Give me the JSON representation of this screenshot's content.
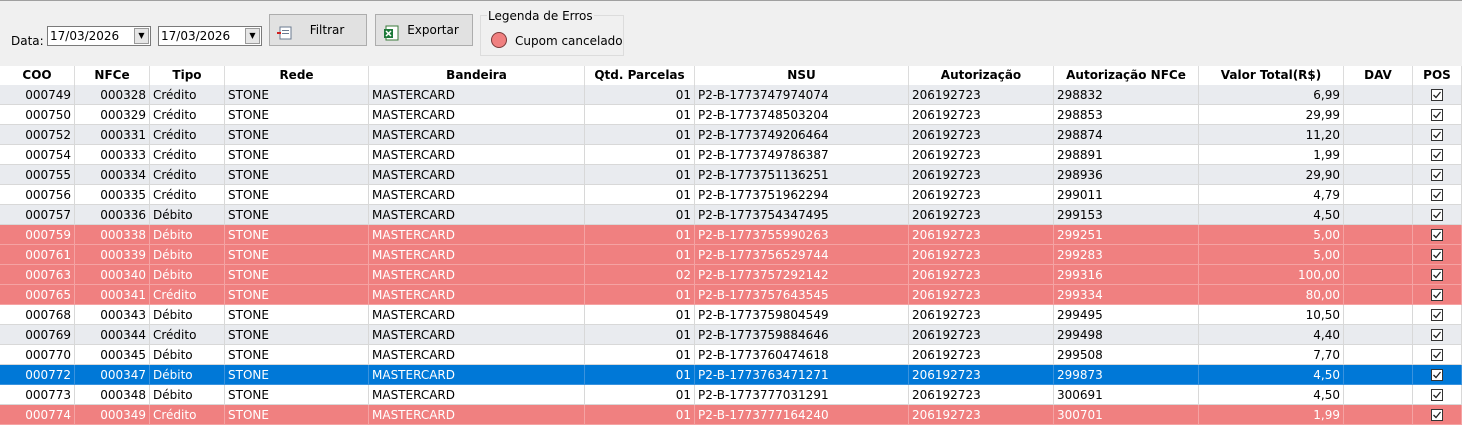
{
  "filter": {
    "date_label": "Data:",
    "date_from": "17/03/2026",
    "date_to": "17/03/2026",
    "filter_button": "Filtrar",
    "export_button": "Exportar"
  },
  "legend": {
    "title": "Legenda de Erros",
    "items": [
      {
        "label": "Cupom cancelado",
        "color": "#f08080"
      }
    ]
  },
  "colors": {
    "error_row": "#f08080",
    "selected_row": "#0078d7",
    "alt_row": "#e9ebef"
  },
  "table": {
    "columns": [
      "COO",
      "NFCe",
      "Tipo",
      "Rede",
      "Bandeira",
      "Qtd. Parcelas",
      "NSU",
      "Autorização",
      "Autorização NFCe",
      "Valor Total(R$)",
      "DAV",
      "POS"
    ],
    "rows": [
      {
        "coo": "000749",
        "nfce": "000328",
        "tipo": "Crédito",
        "rede": "STONE",
        "bandeira": "MASTERCARD",
        "parcelas": "01",
        "nsu": "P2-B-1773747974074",
        "autorizacao": "206192723",
        "autorizacao_nfce": "298832",
        "valor": "6,99",
        "dav": "",
        "pos": true,
        "state": "odd"
      },
      {
        "coo": "000750",
        "nfce": "000329",
        "tipo": "Crédito",
        "rede": "STONE",
        "bandeira": "MASTERCARD",
        "parcelas": "01",
        "nsu": "P2-B-1773748503204",
        "autorizacao": "206192723",
        "autorizacao_nfce": "298853",
        "valor": "29,99",
        "dav": "",
        "pos": true,
        "state": "even"
      },
      {
        "coo": "000752",
        "nfce": "000331",
        "tipo": "Crédito",
        "rede": "STONE",
        "bandeira": "MASTERCARD",
        "parcelas": "01",
        "nsu": "P2-B-1773749206464",
        "autorizacao": "206192723",
        "autorizacao_nfce": "298874",
        "valor": "11,20",
        "dav": "",
        "pos": true,
        "state": "odd"
      },
      {
        "coo": "000754",
        "nfce": "000333",
        "tipo": "Crédito",
        "rede": "STONE",
        "bandeira": "MASTERCARD",
        "parcelas": "01",
        "nsu": "P2-B-1773749786387",
        "autorizacao": "206192723",
        "autorizacao_nfce": "298891",
        "valor": "1,99",
        "dav": "",
        "pos": true,
        "state": "even"
      },
      {
        "coo": "000755",
        "nfce": "000334",
        "tipo": "Crédito",
        "rede": "STONE",
        "bandeira": "MASTERCARD",
        "parcelas": "01",
        "nsu": "P2-B-1773751136251",
        "autorizacao": "206192723",
        "autorizacao_nfce": "298936",
        "valor": "29,90",
        "dav": "",
        "pos": true,
        "state": "odd"
      },
      {
        "coo": "000756",
        "nfce": "000335",
        "tipo": "Crédito",
        "rede": "STONE",
        "bandeira": "MASTERCARD",
        "parcelas": "01",
        "nsu": "P2-B-1773751962294",
        "autorizacao": "206192723",
        "autorizacao_nfce": "299011",
        "valor": "4,79",
        "dav": "",
        "pos": true,
        "state": "even"
      },
      {
        "coo": "000757",
        "nfce": "000336",
        "tipo": "Débito",
        "rede": "STONE",
        "bandeira": "MASTERCARD",
        "parcelas": "01",
        "nsu": "P2-B-1773754347495",
        "autorizacao": "206192723",
        "autorizacao_nfce": "299153",
        "valor": "4,50",
        "dav": "",
        "pos": true,
        "state": "odd"
      },
      {
        "coo": "000759",
        "nfce": "000338",
        "tipo": "Débito",
        "rede": "STONE",
        "bandeira": "MASTERCARD",
        "parcelas": "01",
        "nsu": "P2-B-1773755990263",
        "autorizacao": "206192723",
        "autorizacao_nfce": "299251",
        "valor": "5,00",
        "dav": "",
        "pos": true,
        "state": "err"
      },
      {
        "coo": "000761",
        "nfce": "000339",
        "tipo": "Débito",
        "rede": "STONE",
        "bandeira": "MASTERCARD",
        "parcelas": "01",
        "nsu": "P2-B-1773756529744",
        "autorizacao": "206192723",
        "autorizacao_nfce": "299283",
        "valor": "5,00",
        "dav": "",
        "pos": true,
        "state": "err"
      },
      {
        "coo": "000763",
        "nfce": "000340",
        "tipo": "Débito",
        "rede": "STONE",
        "bandeira": "MASTERCARD",
        "parcelas": "02",
        "nsu": "P2-B-1773757292142",
        "autorizacao": "206192723",
        "autorizacao_nfce": "299316",
        "valor": "100,00",
        "dav": "",
        "pos": true,
        "state": "err"
      },
      {
        "coo": "000765",
        "nfce": "000341",
        "tipo": "Crédito",
        "rede": "STONE",
        "bandeira": "MASTERCARD",
        "parcelas": "01",
        "nsu": "P2-B-1773757643545",
        "autorizacao": "206192723",
        "autorizacao_nfce": "299334",
        "valor": "80,00",
        "dav": "",
        "pos": true,
        "state": "err"
      },
      {
        "coo": "000768",
        "nfce": "000343",
        "tipo": "Débito",
        "rede": "STONE",
        "bandeira": "MASTERCARD",
        "parcelas": "01",
        "nsu": "P2-B-1773759804549",
        "autorizacao": "206192723",
        "autorizacao_nfce": "299495",
        "valor": "10,50",
        "dav": "",
        "pos": true,
        "state": "even"
      },
      {
        "coo": "000769",
        "nfce": "000344",
        "tipo": "Crédito",
        "rede": "STONE",
        "bandeira": "MASTERCARD",
        "parcelas": "01",
        "nsu": "P2-B-1773759884646",
        "autorizacao": "206192723",
        "autorizacao_nfce": "299498",
        "valor": "4,40",
        "dav": "",
        "pos": true,
        "state": "odd"
      },
      {
        "coo": "000770",
        "nfce": "000345",
        "tipo": "Débito",
        "rede": "STONE",
        "bandeira": "MASTERCARD",
        "parcelas": "01",
        "nsu": "P2-B-1773760474618",
        "autorizacao": "206192723",
        "autorizacao_nfce": "299508",
        "valor": "7,70",
        "dav": "",
        "pos": true,
        "state": "even"
      },
      {
        "coo": "000772",
        "nfce": "000347",
        "tipo": "Débito",
        "rede": "STONE",
        "bandeira": "MASTERCARD",
        "parcelas": "01",
        "nsu": "P2-B-1773763471271",
        "autorizacao": "206192723",
        "autorizacao_nfce": "299873",
        "valor": "4,50",
        "dav": "",
        "pos": true,
        "state": "sel"
      },
      {
        "coo": "000773",
        "nfce": "000348",
        "tipo": "Débito",
        "rede": "STONE",
        "bandeira": "MASTERCARD",
        "parcelas": "01",
        "nsu": "P2-B-1773777031291",
        "autorizacao": "206192723",
        "autorizacao_nfce": "300691",
        "valor": "4,50",
        "dav": "",
        "pos": true,
        "state": "even"
      },
      {
        "coo": "000774",
        "nfce": "000349",
        "tipo": "Crédito",
        "rede": "STONE",
        "bandeira": "MASTERCARD",
        "parcelas": "01",
        "nsu": "P2-B-1773777164240",
        "autorizacao": "206192723",
        "autorizacao_nfce": "300701",
        "valor": "1,99",
        "dav": "",
        "pos": true,
        "state": "err"
      }
    ]
  }
}
